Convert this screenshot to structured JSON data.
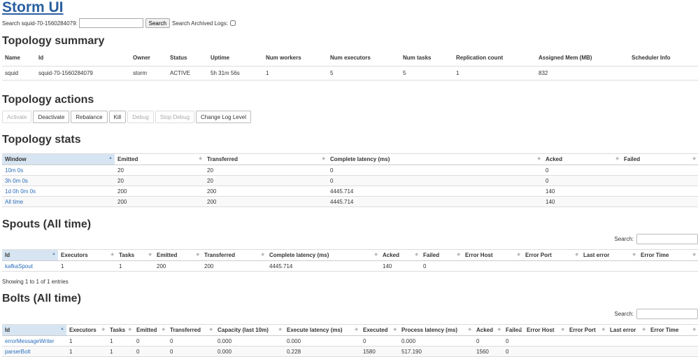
{
  "app": {
    "title": "Storm UI"
  },
  "search": {
    "label": "Search squid-70-1560284079:",
    "value": "",
    "button": "Search",
    "archived_label": "Search Archived Logs:"
  },
  "summary": {
    "title": "Topology summary",
    "headers": [
      "Name",
      "Id",
      "Owner",
      "Status",
      "Uptime",
      "Num workers",
      "Num executors",
      "Num tasks",
      "Replication count",
      "Assigned Mem (MB)",
      "Scheduler Info"
    ],
    "row": [
      "squid",
      "squid-70-1560284079",
      "storm",
      "ACTIVE",
      "5h 31m 56s",
      "1",
      "5",
      "5",
      "1",
      "832",
      ""
    ]
  },
  "actions": {
    "title": "Topology actions",
    "buttons": [
      "Activate",
      "Deactivate",
      "Rebalance",
      "Kill",
      "Debug",
      "Stop Debug",
      "Change Log Level"
    ],
    "disabled": [
      true,
      false,
      false,
      false,
      true,
      true,
      false
    ]
  },
  "stats": {
    "title": "Topology stats",
    "headers": [
      "Window",
      "Emitted",
      "Transferred",
      "Complete latency (ms)",
      "Acked",
      "Failed"
    ],
    "rows": [
      [
        "10m 0s",
        "20",
        "20",
        "0",
        "0",
        ""
      ],
      [
        "3h 0m 0s",
        "20",
        "20",
        "0",
        "0",
        ""
      ],
      [
        "1d 0h 0m 0s",
        "200",
        "200",
        "4445.714",
        "140",
        ""
      ],
      [
        "All time",
        "200",
        "200",
        "4445.714",
        "140",
        ""
      ]
    ]
  },
  "spouts": {
    "title": "Spouts (All time)",
    "search_label": "Search:",
    "headers": [
      "Id",
      "Executors",
      "Tasks",
      "Emitted",
      "Transferred",
      "Complete latency (ms)",
      "Acked",
      "Failed",
      "Error Host",
      "Error Port",
      "Last error",
      "Error Time"
    ],
    "rows": [
      [
        "kafkaSpout",
        "1",
        "1",
        "200",
        "200",
        "4445.714",
        "140",
        "0",
        "",
        "",
        "",
        ""
      ]
    ],
    "info": "Showing 1 to 1 of 1 entries"
  },
  "bolts": {
    "title": "Bolts (All time)",
    "search_label": "Search:",
    "headers": [
      "Id",
      "Executors",
      "Tasks",
      "Emitted",
      "Transferred",
      "Capacity (last 10m)",
      "Execute latency (ms)",
      "Executed",
      "Process latency (ms)",
      "Acked",
      "Failed",
      "Error Host",
      "Error Port",
      "Last error",
      "Error Time"
    ],
    "rows": [
      [
        "errorMessageWriter",
        "1",
        "1",
        "0",
        "0",
        "0.000",
        "0.000",
        "0",
        "0.000",
        "0",
        "0",
        "",
        "",
        "",
        ""
      ],
      [
        "parserBolt",
        "1",
        "1",
        "0",
        "0",
        "0.000",
        "0.228",
        "1580",
        "517.190",
        "1560",
        "0",
        "",
        "",
        "",
        ""
      ]
    ]
  }
}
